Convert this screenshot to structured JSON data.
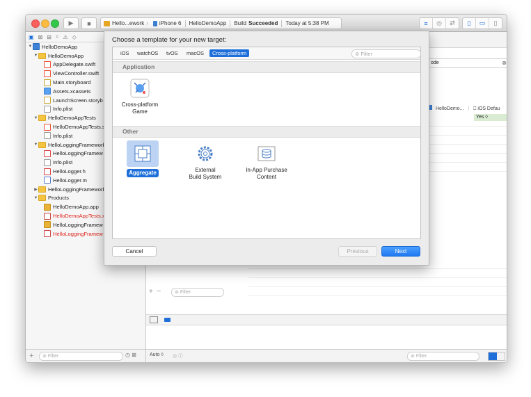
{
  "toolbar": {
    "run_icon": "play-icon",
    "stop_icon": "stop-icon",
    "scheme": "Hello...ework",
    "device": "iPhone 6",
    "project": "HelloDemoApp",
    "build_prefix": "Build",
    "build_status": "Succeeded",
    "build_time": "Today at 5:38 PM"
  },
  "navigator": {
    "tree": [
      {
        "label": "HelloDemoApp",
        "indent": 0,
        "icon": "project",
        "disclosure": "▼"
      },
      {
        "label": "HelloDemoApp",
        "indent": 1,
        "icon": "folder",
        "disclosure": "▼"
      },
      {
        "label": "AppDelegate.swift",
        "indent": 2,
        "icon": "swift"
      },
      {
        "label": "ViewController.swift",
        "indent": 2,
        "icon": "swift"
      },
      {
        "label": "Main.storyboard",
        "indent": 2,
        "icon": "story"
      },
      {
        "label": "Assets.xcassets",
        "indent": 2,
        "icon": "asset"
      },
      {
        "label": "LaunchScreen.storyb",
        "indent": 2,
        "icon": "story"
      },
      {
        "label": "Info.plist",
        "indent": 2,
        "icon": "plist"
      },
      {
        "label": "HelloDemoAppTests",
        "indent": 1,
        "icon": "folder",
        "disclosure": "▼"
      },
      {
        "label": "HelloDemoAppTests.s",
        "indent": 2,
        "icon": "swift"
      },
      {
        "label": "Info.plist",
        "indent": 2,
        "icon": "plist"
      },
      {
        "label": "HelloLoggingFramework",
        "indent": 1,
        "icon": "folder",
        "disclosure": "▼"
      },
      {
        "label": "HelloLoggingFramew",
        "indent": 2,
        "icon": "h"
      },
      {
        "label": "Info.plist",
        "indent": 2,
        "icon": "plist"
      },
      {
        "label": "HelloLogger.h",
        "indent": 2,
        "icon": "h"
      },
      {
        "label": "HelloLogger.m",
        "indent": 2,
        "icon": "m"
      },
      {
        "label": "HelloLoggingFramework",
        "indent": 1,
        "icon": "folder",
        "disclosure": "▶"
      },
      {
        "label": "Products",
        "indent": 1,
        "icon": "folder",
        "disclosure": "▼"
      },
      {
        "label": "HelloDemoApp.app",
        "indent": 2,
        "icon": "app"
      },
      {
        "label": "HelloDemoAppTests.x",
        "indent": 2,
        "icon": "xc",
        "red": true
      },
      {
        "label": "HelloLoggingFramew",
        "indent": 2,
        "icon": "app"
      },
      {
        "label": "HelloLoggingFramew",
        "indent": 2,
        "icon": "xc",
        "red": true
      }
    ],
    "filter_placeholder": "Filter"
  },
  "editor": {
    "search_text": "ode",
    "target_name": "HelloDemo...",
    "ios_default": "iOS Defau",
    "yes_value": "Yes ◊",
    "target_filter_placeholder": "Filter",
    "auto_label": "Auto ◊",
    "console_filter_placeholder": "Filter"
  },
  "sheet": {
    "title": "Choose a template for your new target:",
    "platforms": [
      "iOS",
      "watchOS",
      "tvOS",
      "macOS",
      "Cross-platform"
    ],
    "selected_platform": "Cross-platform",
    "filter_placeholder": "Filter",
    "sections": [
      {
        "name": "Application",
        "templates": [
          {
            "label": "Cross-platform Game",
            "icon": "game-icon"
          }
        ]
      },
      {
        "name": "Other",
        "templates": [
          {
            "label": "Aggregate",
            "icon": "aggregate-icon",
            "selected": true
          },
          {
            "label": "External Build System",
            "icon": "gear-icon"
          },
          {
            "label": "In-App Purchase Content",
            "icon": "database-icon"
          }
        ]
      }
    ],
    "tpl_game_l1": "Cross-platform",
    "tpl_game_l2": "Game",
    "tpl_aggregate": "Aggregate",
    "tpl_external_l1": "External",
    "tpl_external_l2": "Build System",
    "tpl_iap_l1": "In-App Purchase",
    "tpl_iap_l2": "Content",
    "cancel_label": "Cancel",
    "previous_label": "Previous",
    "next_label": "Next"
  },
  "colors": {
    "accent": "#1e6fd9",
    "next_button": "#1f78f0",
    "error_red": "#e0261d"
  }
}
